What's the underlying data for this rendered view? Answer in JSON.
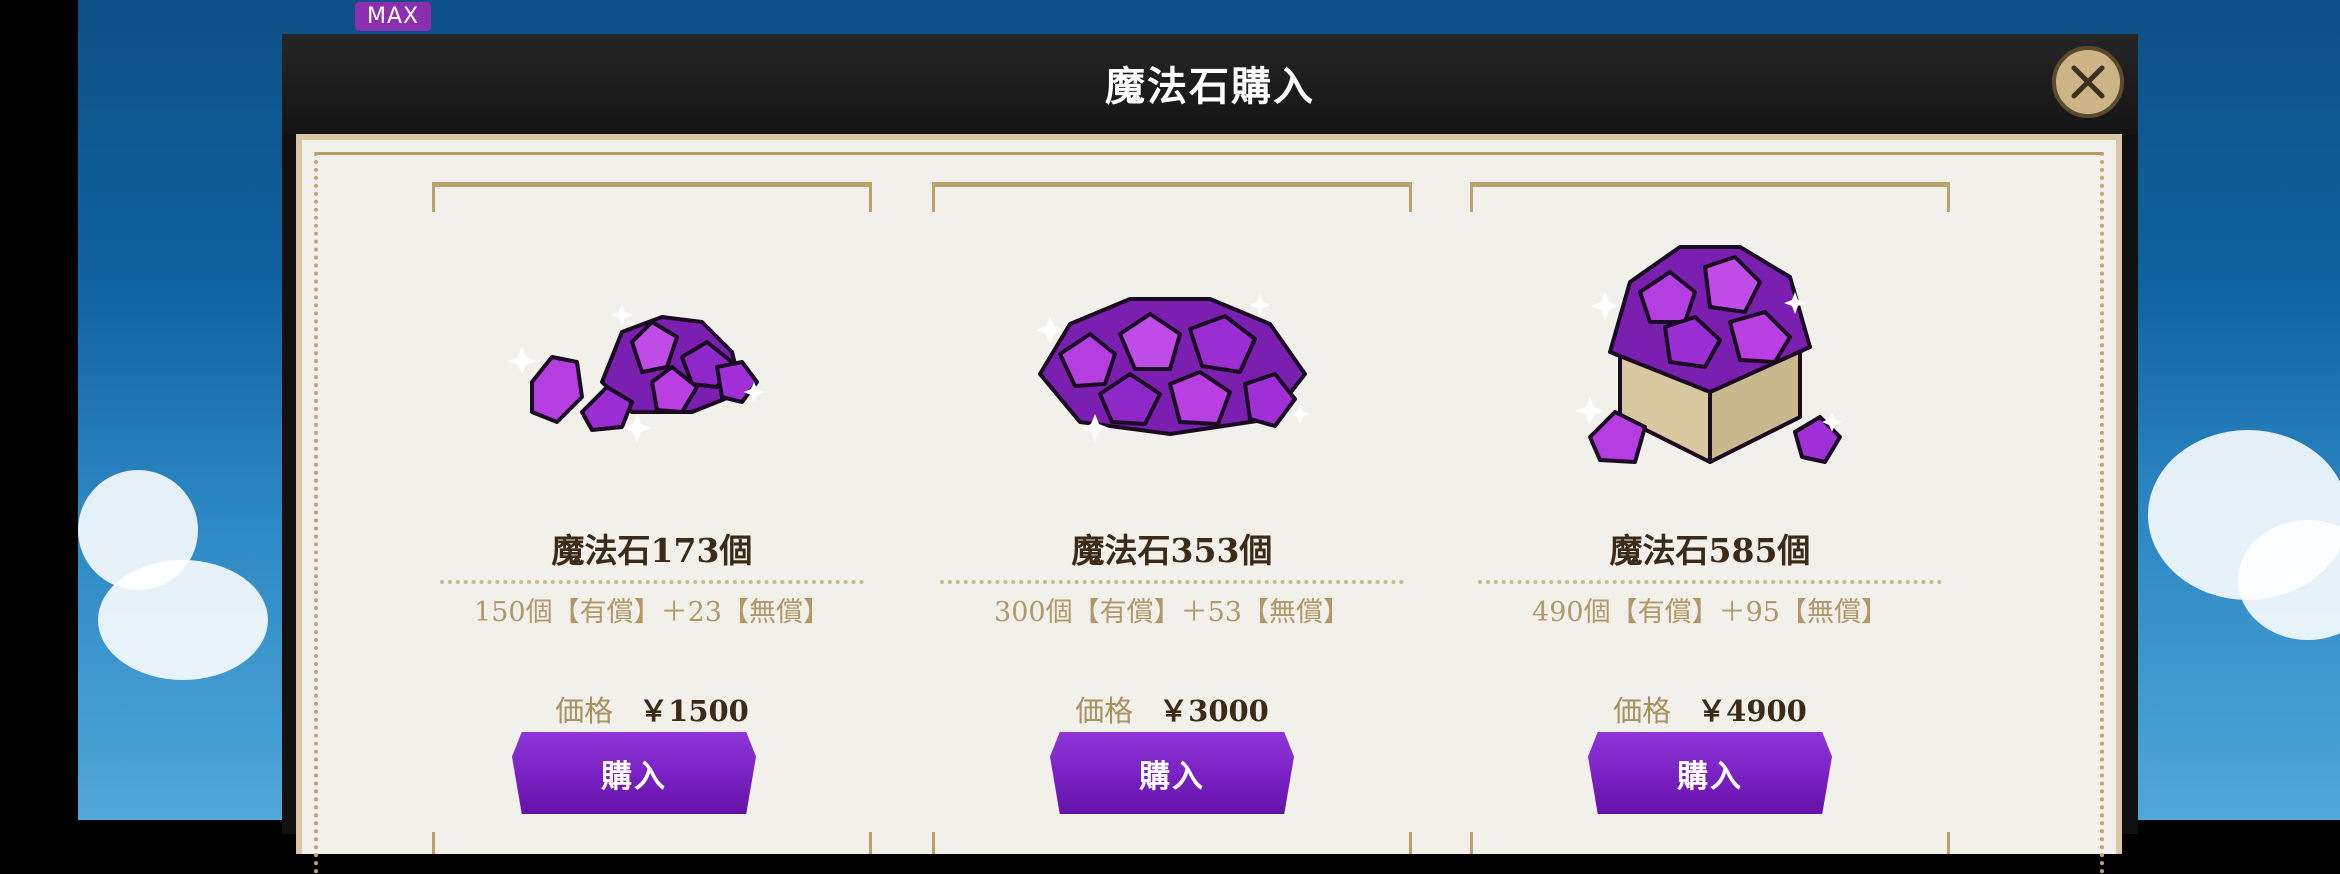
{
  "header": {
    "max_badge": "MAX"
  },
  "modal": {
    "title": "魔法石購入",
    "close_icon": "close-icon"
  },
  "products": [
    {
      "name": "魔法石173個",
      "detail": "150個【有償】＋23【無償】",
      "price_label": "価格",
      "price": "￥1500",
      "buy_label": "購入"
    },
    {
      "name": "魔法石353個",
      "detail": "300個【有償】＋53【無償】",
      "price_label": "価格",
      "price": "￥3000",
      "buy_label": "購入"
    },
    {
      "name": "魔法石585個",
      "detail": "490個【有償】＋95【無償】",
      "price_label": "価格",
      "price": "￥4900",
      "buy_label": "購入"
    }
  ],
  "colors": {
    "accent": "#7a22c4",
    "gem": "#9b3ad1",
    "frame": "#b9a26c",
    "panel": "#f2f0ea"
  }
}
